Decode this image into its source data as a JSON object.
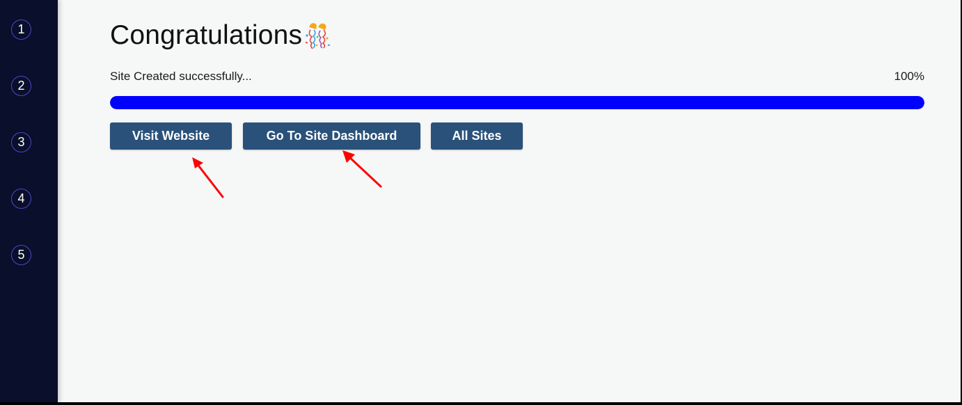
{
  "sidebar": {
    "steps": [
      "1",
      "2",
      "3",
      "4",
      "5"
    ]
  },
  "main": {
    "title": "Congratulations",
    "title_icon": "confetti-icon",
    "status_text": "Site Created successfully...",
    "progress_label": "100%",
    "progress_fraction": 1.0,
    "progress_color": "#0000ff",
    "buttons": {
      "visit_website": "Visit Website",
      "site_dashboard": "Go To Site Dashboard",
      "all_sites": "All Sites"
    },
    "button_color": "#2a5179",
    "annotation_color": "#ff0000"
  }
}
